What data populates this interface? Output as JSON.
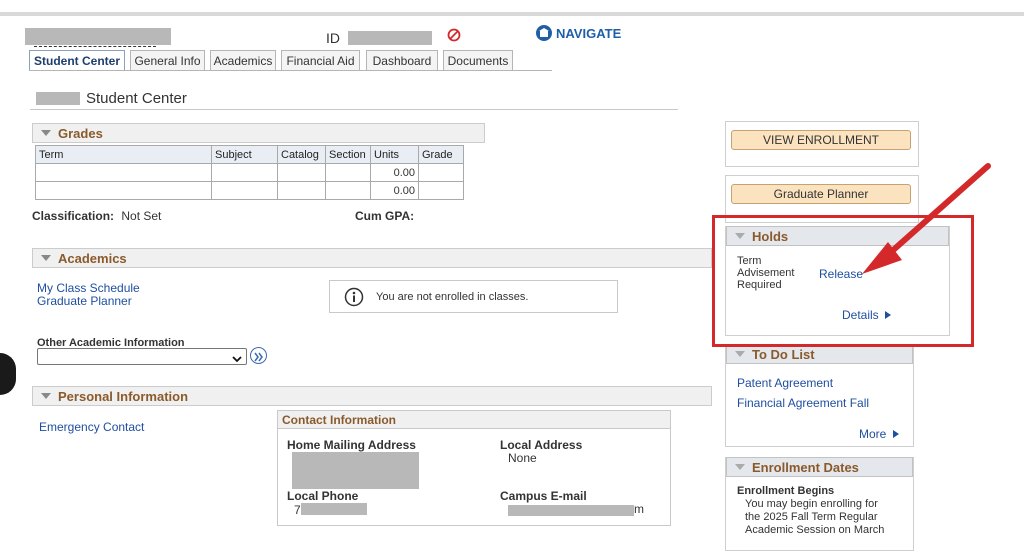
{
  "header": {
    "id_label": "ID",
    "navigate_label": "NAVIGATE"
  },
  "tabs": [
    {
      "label": "Student Center",
      "active": true
    },
    {
      "label": "General Info"
    },
    {
      "label": "Academics"
    },
    {
      "label": "Financial Aid"
    },
    {
      "label": "Dashboard"
    },
    {
      "label": "Documents"
    }
  ],
  "page_title": "Student Center",
  "grades": {
    "header": "Grades",
    "columns": [
      "Term",
      "Subject",
      "Catalog",
      "Section",
      "Units",
      "Grade"
    ],
    "rows": [
      [
        "",
        "",
        "",
        "",
        "0.00",
        ""
      ],
      [
        "",
        "",
        "",
        "",
        "0.00",
        ""
      ]
    ]
  },
  "classification": {
    "label": "Classification:",
    "value": "Not Set"
  },
  "cum_gpa": {
    "label": "Cum GPA:"
  },
  "academics": {
    "header": "Academics",
    "links": [
      "My Class Schedule",
      "Graduate Planner"
    ],
    "notice": "You are not enrolled in classes.",
    "other_label": "Other Academic Information"
  },
  "personal": {
    "header": "Personal Information",
    "emergency_link": "Emergency Contact",
    "contact_header": "Contact Information",
    "home_label": "Home Mailing Address",
    "local_address_label": "Local Address",
    "local_address_value": "None",
    "local_phone_label": "Local Phone",
    "local_phone_prefix": "7",
    "campus_email_label": "Campus E-mail",
    "campus_email_suffix": "m"
  },
  "sidebar": {
    "view_enrollment": "VIEW ENROLLMENT",
    "graduate_planner": "Graduate Planner",
    "holds": {
      "header": "Holds",
      "item": "Term Advisement Required",
      "action": "Release",
      "details": "Details"
    },
    "todo": {
      "header": "To Do List",
      "items": [
        "Patent Agreement",
        "Financial Agreement Fall"
      ],
      "more": "More"
    },
    "enrollment_dates": {
      "header": "Enrollment Dates",
      "subheader": "Enrollment Begins",
      "text": "You may begin enrolling for the 2025 Fall Term Regular Academic Session on March"
    }
  },
  "icons": {
    "no_entry": "no-entry-icon",
    "navigate": "navigate-icon",
    "info": "info-icon",
    "go": "double-chevron-right-icon"
  },
  "colors": {
    "annotation_red": "#d3292a",
    "link_blue": "#1f4fa0",
    "header_brown": "#8a5a2b"
  }
}
